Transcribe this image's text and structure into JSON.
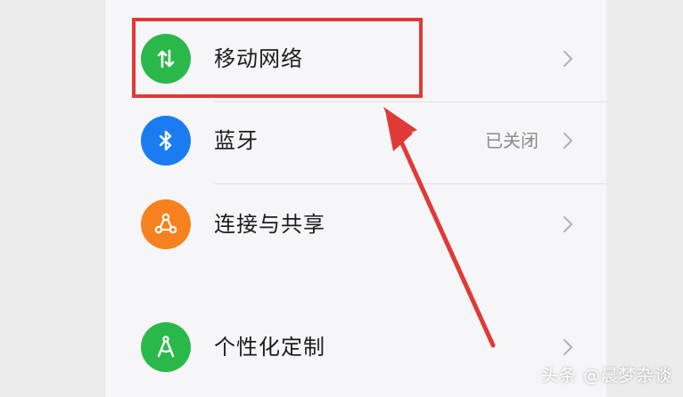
{
  "settings": {
    "items": [
      {
        "label": "移动网络",
        "value": "",
        "icon": "mobile-data-icon",
        "color": "#2bb84a"
      },
      {
        "label": "蓝牙",
        "value": "已关闭",
        "icon": "bluetooth-icon",
        "color": "#1a7cf0"
      },
      {
        "label": "连接与共享",
        "value": "",
        "icon": "share-icon",
        "color": "#f5821f"
      },
      {
        "label": "个性化定制",
        "value": "",
        "icon": "personalize-icon",
        "color": "#2bb84a"
      }
    ]
  },
  "annotation": {
    "color": "#e03a36"
  },
  "watermark": {
    "text": "头条 @晨梦杂谈"
  }
}
